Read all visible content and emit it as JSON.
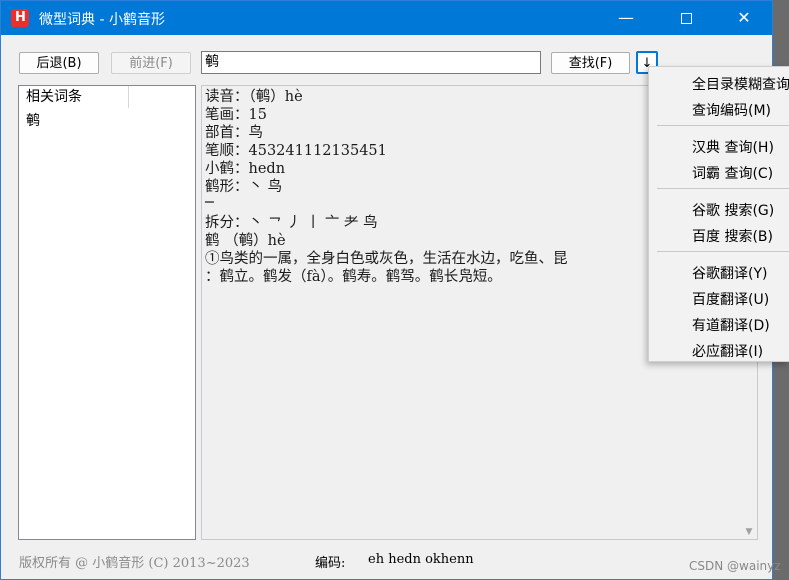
{
  "window": {
    "title": "微型词典 - 小鹤音形",
    "icon_label": "H",
    "controls": {
      "minimize": "—",
      "close": "✕"
    }
  },
  "toolbar": {
    "back_label": "后退(B)",
    "forward_label": "前进(F)",
    "search_value": "鹌",
    "find_label": "查找(F)",
    "dropdown_label": "↓"
  },
  "left_panel": {
    "header": "相关词条",
    "items": [
      "鹌"
    ]
  },
  "content": {
    "lines": [
      "读音：（鹌）hè",
      "笔画：15",
      "部首：鸟",
      "笔顺：453241112135451",
      "小鹤：hedn",
      "鹤形：丶 鸟",
      " ─",
      "拆分：丶 ㇖ 丿 丨 亠 耂 鸟",
      "鹤 （鹌）hè",
      "①鸟类的一属，全身白色或灰色，生活在水边，吃鱼、昆",
      "：鹤立。鹤发（fà）。鹤寿。鹤驾。鹤长凫短。"
    ]
  },
  "footer": {
    "copyright": "版权所有 @ 小鹤音形 (C) 2013~2023",
    "code_label": "编码:",
    "code_value": "eh hedn okhenn"
  },
  "menu": {
    "items": [
      "全目录模糊查询",
      "查询编码(M)",
      "汉典 查询(H)",
      "词霸 查询(C)",
      "谷歌 搜索(G)",
      "百度 搜索(B)",
      "谷歌翻译(Y)",
      "百度翻译(U)",
      "有道翻译(D)",
      "必应翻译(I)"
    ]
  },
  "watermark": "CSDN @wainyz",
  "colors": {
    "titlebar": "#0078d7",
    "window_bg": "#f0f0f0",
    "icon_red": "#e8312f"
  }
}
